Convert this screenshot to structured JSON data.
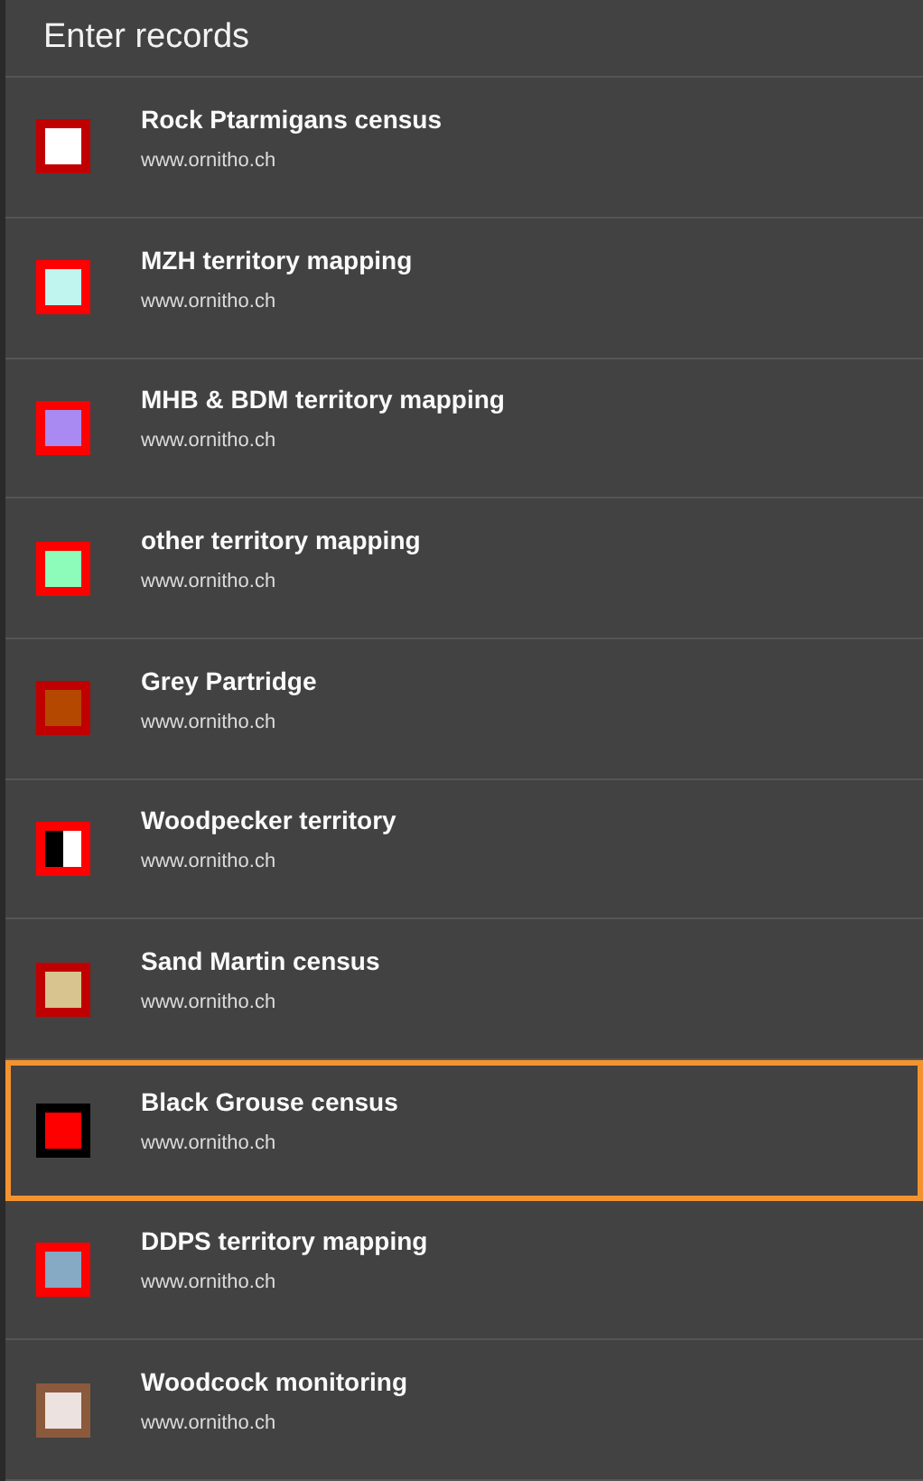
{
  "header": {
    "title": "Enter records"
  },
  "items": [
    {
      "title": "Rock Ptarmigans census",
      "url": "www.ornitho.ch",
      "selected": false,
      "kind": "solid",
      "color": "#c00000",
      "fills": [
        {
          "color": "#ffffff"
        }
      ]
    },
    {
      "title": "MZH territory mapping",
      "url": "www.ornitho.ch",
      "selected": false,
      "kind": "solid",
      "color": "#ff0000",
      "fills": [
        {
          "color": "#c0f4ee"
        }
      ]
    },
    {
      "title": "MHB & BDM territory mapping",
      "url": "www.ornitho.ch",
      "selected": false,
      "kind": "solid",
      "color": "#ff0000",
      "fills": [
        {
          "color": "#a98af2"
        }
      ]
    },
    {
      "title": "other territory mapping",
      "url": "www.ornitho.ch",
      "selected": false,
      "kind": "solid",
      "color": "#ff0000",
      "fills": [
        {
          "color": "#8dfcbb"
        }
      ]
    },
    {
      "title": "Grey Partridge",
      "url": "www.ornitho.ch",
      "selected": false,
      "kind": "solid",
      "color": "#c00000",
      "fills": [
        {
          "color": "#b54800"
        }
      ]
    },
    {
      "title": "Woodpecker territory",
      "url": "www.ornitho.ch",
      "selected": false,
      "kind": "split",
      "color": "#ff0000",
      "fills": [
        {
          "color": "#000000"
        },
        {
          "color": "#ffffff"
        }
      ]
    },
    {
      "title": "Sand Martin census",
      "url": "www.ornitho.ch",
      "selected": false,
      "kind": "solid",
      "color": "#c00000",
      "fills": [
        {
          "color": "#d8c48e"
        }
      ]
    },
    {
      "title": "Black Grouse census",
      "url": "www.ornitho.ch",
      "selected": true,
      "kind": "solid",
      "color": "#000000",
      "fills": [
        {
          "color": "#ff0000"
        }
      ]
    },
    {
      "title": "DDPS territory mapping",
      "url": "www.ornitho.ch",
      "selected": false,
      "kind": "solid",
      "color": "#ff0000",
      "fills": [
        {
          "color": "#86a9c4"
        }
      ]
    },
    {
      "title": "Woodcock monitoring",
      "url": "www.ornitho.ch",
      "selected": false,
      "kind": "solid",
      "color": "#8b5a3c",
      "fills": [
        {
          "color": "#ece2df"
        }
      ]
    }
  ]
}
